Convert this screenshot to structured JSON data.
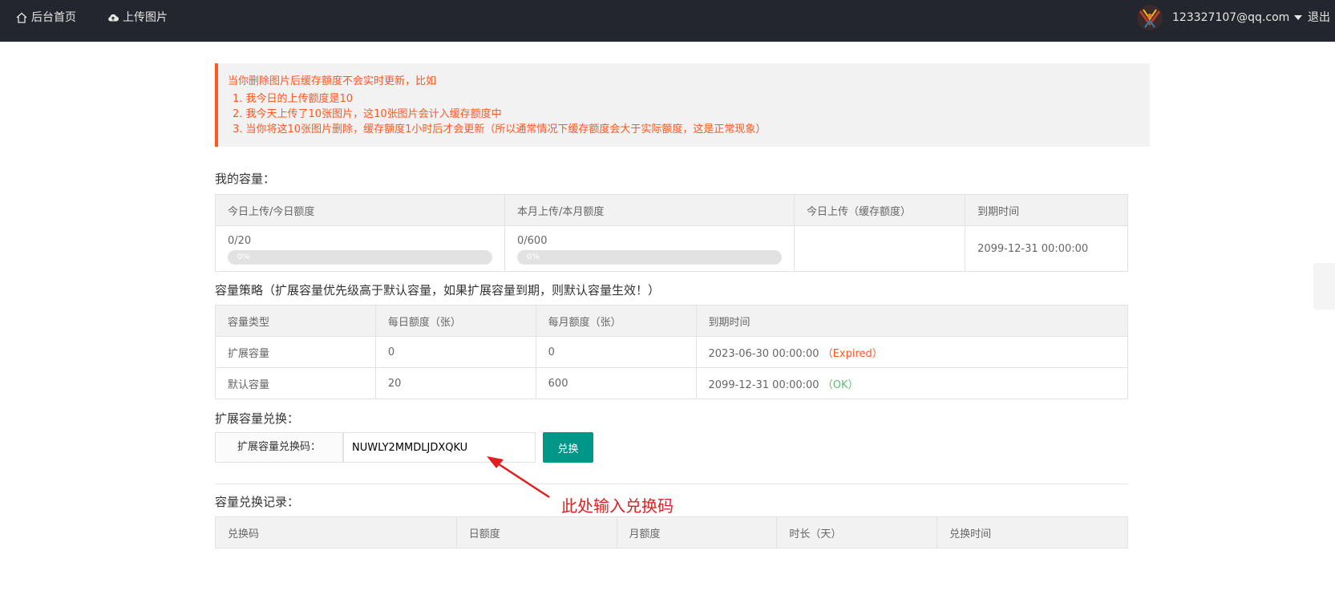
{
  "nav": {
    "home_label": "后台首页",
    "upload_label": "上传图片",
    "user_email": "123327107@qq.com",
    "logout_label": "退出"
  },
  "notice": {
    "title": "当你删除图片后缓存额度不会实时更新，比如",
    "items": [
      "1. 我今日的上传额度是10",
      "2. 我今天上传了10张图片，这10张图片会计入缓存额度中",
      "3. 当你将这10张图片删除，缓存额度1小时后才会更新（所以通常情况下缓存额度会大于实际额度，这是正常现象）"
    ]
  },
  "capacity": {
    "title": "我的容量：",
    "headers": [
      "今日上传/今日额度",
      "本月上传/本月额度",
      "今日上传（缓存额度）",
      "到期时间"
    ],
    "today_value": "0/20",
    "today_progress_text": "0%",
    "today_progress": 0,
    "month_value": "0/600",
    "month_progress_text": "0%",
    "month_progress": 0,
    "cache_value": "",
    "expire": "2099-12-31 00:00:00"
  },
  "policy": {
    "title": "容量策略（扩展容量优先级高于默认容量，如果扩展容量到期，则默认容量生效！）",
    "headers": [
      "容量类型",
      "每日额度（张）",
      "每月额度（张）",
      "到期时间"
    ],
    "rows": [
      {
        "type": "扩展容量",
        "daily": "0",
        "monthly": "0",
        "expire": "2023-06-30 00:00:00",
        "status": "（Expired）"
      },
      {
        "type": "默认容量",
        "daily": "20",
        "monthly": "600",
        "expire": "2099-12-31 00:00:00",
        "status": "（OK）"
      }
    ]
  },
  "redeem": {
    "title": "扩展容量兑换：",
    "label": "扩展容量兑换码：",
    "value": "NUWLY2MMDLJDXQKU",
    "button": "兑换"
  },
  "annotation": {
    "text": "此处输入兑换码"
  },
  "records": {
    "title": "容量兑换记录：",
    "headers": [
      "兑换码",
      "日额度",
      "月额度",
      "时长（天）",
      "兑换时间"
    ]
  },
  "colors": {
    "topbar": "#23262e",
    "notice_accent": "#ff5722",
    "button": "#009688",
    "ok": "#5fb878",
    "annotation": "#e02020"
  }
}
